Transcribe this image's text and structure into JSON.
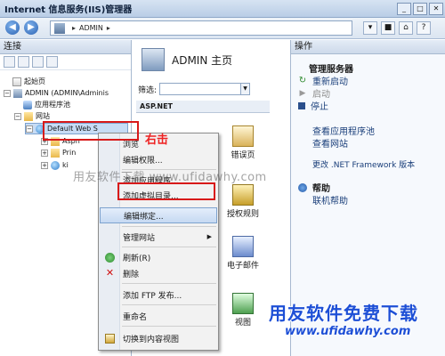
{
  "window": {
    "title": "Internet 信息服务(IIS)管理器"
  },
  "address": {
    "crumbs": [
      "ADMIN"
    ]
  },
  "connections": {
    "header": "连接",
    "tree": [
      {
        "label": "起始页"
      },
      {
        "label": "ADMIN (ADMIN\\Adminis"
      },
      {
        "label": "应用程序池"
      },
      {
        "label": "网站"
      },
      {
        "label": "Default Web S"
      },
      {
        "label": "Aspn"
      },
      {
        "label": "Prin"
      },
      {
        "label": "ki"
      }
    ]
  },
  "center": {
    "title": "ADMIN 主页",
    "filter_label": "筛选:",
    "section": "ASP.NET",
    "features": [
      {
        "label": "错误页"
      },
      {
        "label": "授权规则"
      },
      {
        "label": "电子邮件"
      },
      {
        "label": "视图"
      }
    ]
  },
  "actions": {
    "header": "操作",
    "items": {
      "manage_server": "管理服务器",
      "restart": "重新启动",
      "start": "启动",
      "stop": "停止",
      "view_pools": "查看应用程序池",
      "view_sites": "查看网站",
      "change_net": "更改 .NET Framework 版本",
      "help_section": "帮助",
      "online_help": "联机帮助"
    }
  },
  "context_menu": {
    "items": {
      "browse": "浏览",
      "edit_perms": "编辑权限...",
      "add_app": "添加应用程序...",
      "add_vdir": "添加虚拟目录...",
      "edit_bindings": "编辑绑定...",
      "manage_site": "管理网站",
      "refresh": "刷新(R)",
      "delete": "删除",
      "add_ftp": "添加 FTP 发布...",
      "rename": "重命名",
      "switch_view": "切换到内容视图"
    }
  },
  "watermarks": {
    "center": "用友软件下载 www.ufidawhy.com",
    "red": "右击",
    "logo": "用友软件免费下载",
    "logo_url": "www.ufidawhy.com"
  }
}
